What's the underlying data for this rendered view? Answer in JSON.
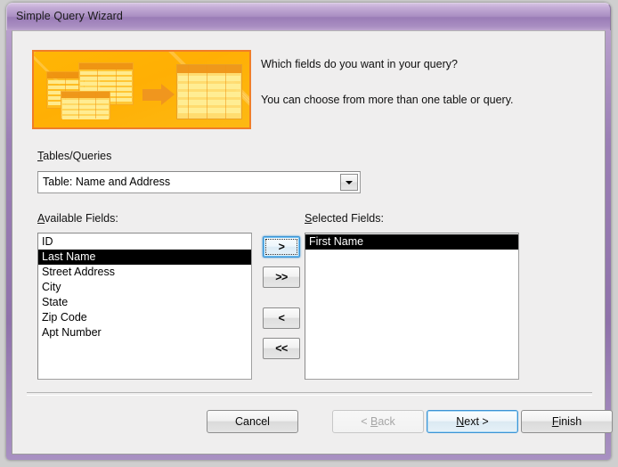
{
  "window": {
    "title": "Simple Query Wizard"
  },
  "header": {
    "prompt_primary": "Which fields do you want in your query?",
    "prompt_secondary": "You can choose from more than one table or query.",
    "banner_icon": "tables-to-query-banner"
  },
  "tables_queries": {
    "label_prefix": "T",
    "label_rest": "ables/Queries",
    "selected_value": "Table: Name and Address",
    "dropdown_icon": "chevron-down-icon"
  },
  "available_fields": {
    "label_prefix": "A",
    "label_rest": "vailable Fields:",
    "items": [
      {
        "text": "ID",
        "selected": false
      },
      {
        "text": "Last Name",
        "selected": true
      },
      {
        "text": "Street Address",
        "selected": false
      },
      {
        "text": "City",
        "selected": false
      },
      {
        "text": "State",
        "selected": false
      },
      {
        "text": "Zip Code",
        "selected": false
      },
      {
        "text": "Apt Number",
        "selected": false
      }
    ]
  },
  "selected_fields": {
    "label_prefix": "S",
    "label_rest": "elected Fields:",
    "items": [
      {
        "text": "First Name",
        "selected": true
      }
    ]
  },
  "transfer_buttons": {
    "add": ">",
    "add_all": ">>",
    "remove": "<",
    "remove_all": "<<"
  },
  "footer": {
    "cancel": "Cancel",
    "back_prefix": "< ",
    "back_accel": "B",
    "back_rest": "ack",
    "next_accel": "N",
    "next_rest": "ext >",
    "finish_accel": "F",
    "finish_rest": "inish"
  },
  "colors": {
    "title_purple": "#9a7cb6",
    "banner_orange": "#ffb605",
    "banner_border": "#f07d28",
    "focus_blue": "#3c93d4",
    "selection_black": "#000000",
    "client_bg": "#efeeee"
  }
}
